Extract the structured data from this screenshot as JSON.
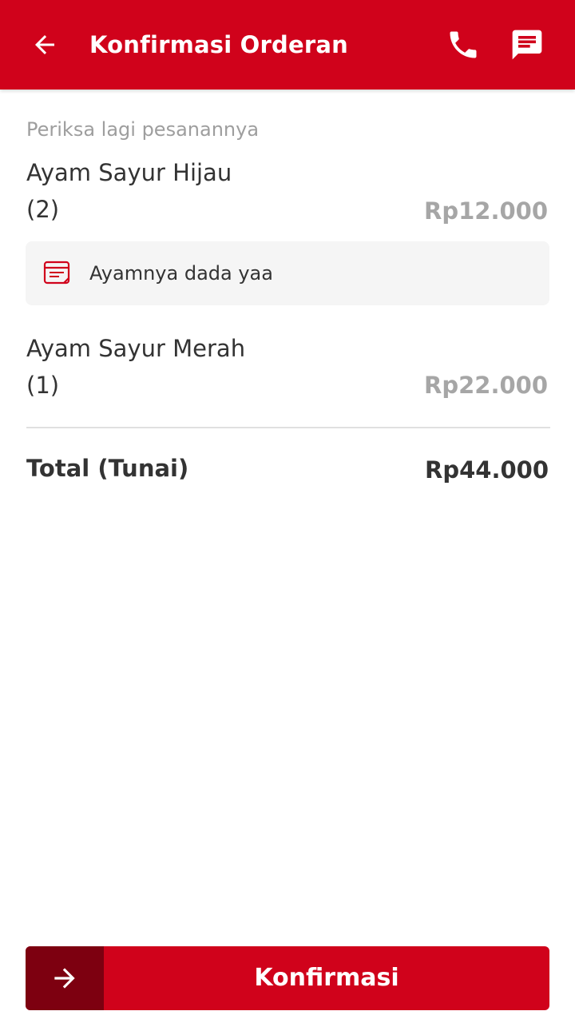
{
  "header": {
    "title": "Konfirmasi Orderan",
    "back_icon": "arrow-left-icon",
    "phone_icon": "phone-icon",
    "chat_icon": "chat-message-icon",
    "background_color": "#d0021b"
  },
  "order": {
    "subtitle": "Periksa lagi pesanannya",
    "items": [
      {
        "name": "Ayam Sayur Hijau",
        "quantity": "(2)",
        "price": "Rp12.000",
        "note": "Ayamnya dada yaa",
        "note_icon": "note-icon"
      },
      {
        "name": "Ayam Sayur Merah",
        "quantity": "(1)",
        "price": "Rp22.000"
      }
    ],
    "total_label": "Total (Tunai)",
    "total_value": "Rp44.000"
  },
  "footer": {
    "confirm_label": "Konfirmasi",
    "confirm_icon": "arrow-right-icon",
    "button_color": "#d0021b",
    "arrow_block_color": "#7d0010"
  }
}
